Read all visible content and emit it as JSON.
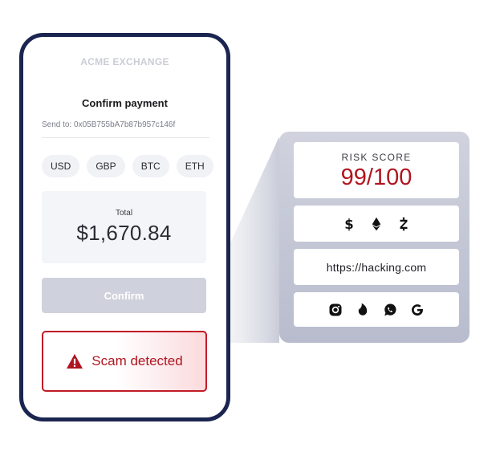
{
  "phone": {
    "brand": "ACME EXCHANGE",
    "title": "Confirm payment",
    "send_to": "Send to: 0x05B755bA7b87b957c146f",
    "currencies": [
      "USD",
      "GBP",
      "BTC",
      "ETH"
    ],
    "total_label": "Total",
    "total_amount": "$1,670.84",
    "confirm_label": "Confirm",
    "alert_text": "Scam detected",
    "alert_icon": "warning-triangle-icon"
  },
  "risk": {
    "score_label": "RISK SCORE",
    "score_value": "99/100",
    "currency_icons": [
      "dollar-icon",
      "ethereum-icon",
      "zcash-icon"
    ],
    "url": "https://hacking.com",
    "social_icons": [
      "instagram-icon",
      "tinder-icon",
      "whatsapp-icon",
      "google-icon"
    ]
  },
  "colors": {
    "phone_frame": "#1a2550",
    "danger": "#b0151f",
    "panel": "#c3c6d4",
    "confirm_disabled": "#cfd1dc"
  }
}
